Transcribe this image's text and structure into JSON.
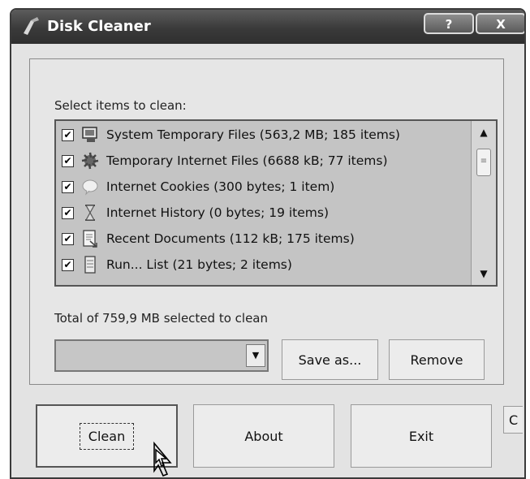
{
  "window": {
    "title": "Disk Cleaner",
    "help_label": "?",
    "close_label": "X"
  },
  "panel": {
    "select_label": "Select items to clean:",
    "items": [
      {
        "checked": true,
        "icon": "system-temp-files-icon",
        "label": "System Temporary Files (563,2 MB; 185 items)"
      },
      {
        "checked": true,
        "icon": "globe-icon",
        "label": "Temporary Internet Files (6688 kB; 77 items)"
      },
      {
        "checked": true,
        "icon": "cookie-icon",
        "label": "Internet Cookies (300 bytes; 1 item)"
      },
      {
        "checked": true,
        "icon": "hourglass-icon",
        "label": "Internet History (0 bytes; 19 items)"
      },
      {
        "checked": true,
        "icon": "documents-icon",
        "label": "Recent Documents (112 kB; 175 items)"
      },
      {
        "checked": true,
        "icon": "run-list-icon",
        "label": "Run... List (21 bytes; 2 items)"
      }
    ],
    "checkmark": "✔",
    "total_label": "Total of 759,9 MB selected to clean",
    "profile_value": "",
    "save_as_label": "Save as...",
    "remove_label": "Remove"
  },
  "buttons": {
    "clean_label": "Clean",
    "about_label": "About",
    "exit_label": "Exit",
    "extra_label": "C"
  }
}
